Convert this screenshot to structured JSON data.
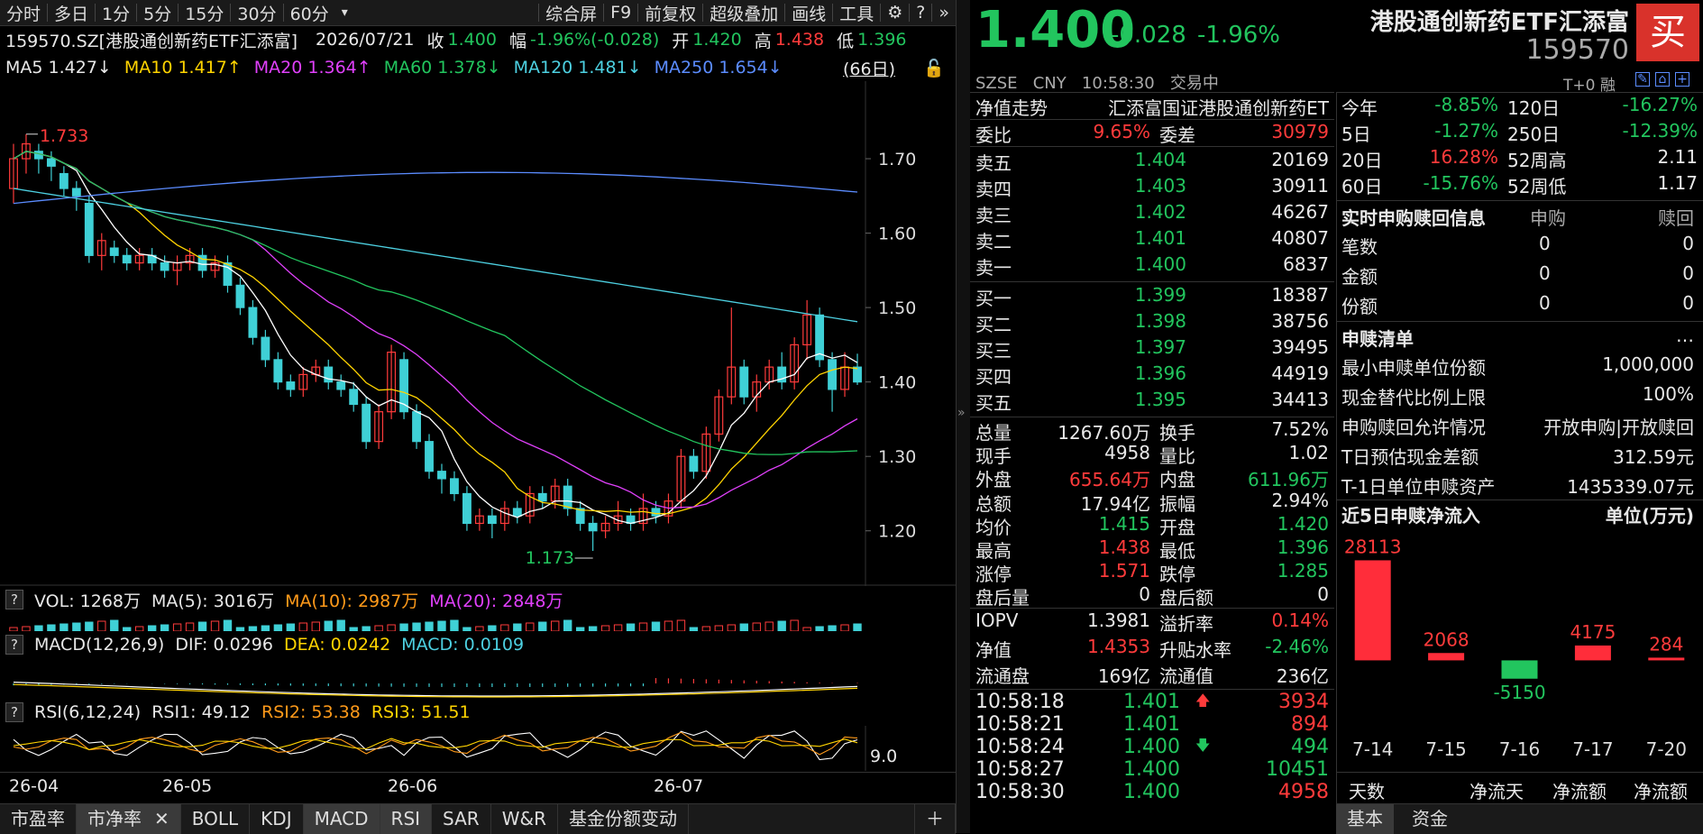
{
  "toolbar": {
    "items": [
      "分时",
      "多日",
      "1分",
      "5分",
      "15分",
      "30分",
      "60分",
      "▾"
    ],
    "right_items": [
      "综合屏",
      "F9",
      "前复权",
      "超级叠加",
      "画线",
      "工具"
    ]
  },
  "info": {
    "code": "159570.SZ[港股通创新药ETF汇添富]",
    "date": "2026/07/21",
    "close_label": "收",
    "close": "1.400",
    "amp_label": "幅",
    "amp": "-1.96%(-0.028)",
    "open_label": "开",
    "open": "1.420",
    "high_label": "高",
    "high": "1.438",
    "low_label": "低",
    "low": "1.396"
  },
  "ma": {
    "ma5": "MA5  1.427↓",
    "ma10": "MA10  1.417↑",
    "ma20": "MA20  1.364↑",
    "ma60": "MA60  1.378↓",
    "ma120": "MA120  1.481↓",
    "ma250": "MA250  1.654↓",
    "period": "(66日)"
  },
  "chart_data": {
    "type": "candlestick",
    "y_ticks": [
      "1.70",
      "1.60",
      "1.50",
      "1.40",
      "1.30",
      "1.20"
    ],
    "ylim": [
      1.15,
      1.78
    ],
    "x_ticks": [
      "26-04",
      "26-05",
      "26-06",
      "26-07"
    ],
    "annotations": {
      "max": "1.733",
      "min": "1.173"
    },
    "candles": [
      [
        1.66,
        1.7,
        1.72,
        1.64
      ],
      [
        1.7,
        1.72,
        1.733,
        1.68
      ],
      [
        1.71,
        1.7,
        1.72,
        1.68
      ],
      [
        1.7,
        1.69,
        1.71,
        1.67
      ],
      [
        1.68,
        1.66,
        1.69,
        1.65
      ],
      [
        1.66,
        1.65,
        1.67,
        1.63
      ],
      [
        1.64,
        1.57,
        1.65,
        1.56
      ],
      [
        1.57,
        1.59,
        1.6,
        1.55
      ],
      [
        1.58,
        1.57,
        1.59,
        1.56
      ],
      [
        1.57,
        1.56,
        1.58,
        1.55
      ],
      [
        1.56,
        1.57,
        1.58,
        1.55
      ],
      [
        1.57,
        1.56,
        1.58,
        1.55
      ],
      [
        1.56,
        1.55,
        1.57,
        1.54
      ],
      [
        1.55,
        1.56,
        1.57,
        1.53
      ],
      [
        1.56,
        1.57,
        1.58,
        1.55
      ],
      [
        1.57,
        1.55,
        1.58,
        1.54
      ],
      [
        1.55,
        1.56,
        1.57,
        1.54
      ],
      [
        1.56,
        1.53,
        1.57,
        1.52
      ],
      [
        1.53,
        1.5,
        1.54,
        1.49
      ],
      [
        1.5,
        1.46,
        1.51,
        1.45
      ],
      [
        1.46,
        1.43,
        1.47,
        1.42
      ],
      [
        1.43,
        1.4,
        1.44,
        1.39
      ],
      [
        1.4,
        1.39,
        1.41,
        1.38
      ],
      [
        1.39,
        1.41,
        1.42,
        1.38
      ],
      [
        1.41,
        1.42,
        1.43,
        1.4
      ],
      [
        1.42,
        1.4,
        1.43,
        1.39
      ],
      [
        1.4,
        1.39,
        1.41,
        1.38
      ],
      [
        1.39,
        1.37,
        1.4,
        1.36
      ],
      [
        1.37,
        1.32,
        1.38,
        1.31
      ],
      [
        1.32,
        1.36,
        1.37,
        1.31
      ],
      [
        1.36,
        1.44,
        1.45,
        1.35
      ],
      [
        1.43,
        1.36,
        1.44,
        1.35
      ],
      [
        1.36,
        1.32,
        1.37,
        1.31
      ],
      [
        1.32,
        1.28,
        1.33,
        1.27
      ],
      [
        1.28,
        1.27,
        1.29,
        1.25
      ],
      [
        1.27,
        1.25,
        1.28,
        1.24
      ],
      [
        1.25,
        1.21,
        1.26,
        1.2
      ],
      [
        1.21,
        1.22,
        1.23,
        1.2
      ],
      [
        1.22,
        1.21,
        1.23,
        1.19
      ],
      [
        1.21,
        1.23,
        1.24,
        1.2
      ],
      [
        1.23,
        1.22,
        1.24,
        1.21
      ],
      [
        1.22,
        1.25,
        1.26,
        1.21
      ],
      [
        1.25,
        1.24,
        1.26,
        1.23
      ],
      [
        1.24,
        1.26,
        1.27,
        1.23
      ],
      [
        1.26,
        1.23,
        1.27,
        1.22
      ],
      [
        1.23,
        1.21,
        1.24,
        1.2
      ],
      [
        1.21,
        1.2,
        1.22,
        1.173
      ],
      [
        1.2,
        1.21,
        1.22,
        1.19
      ],
      [
        1.21,
        1.22,
        1.24,
        1.2
      ],
      [
        1.22,
        1.21,
        1.23,
        1.2
      ],
      [
        1.21,
        1.23,
        1.25,
        1.2
      ],
      [
        1.23,
        1.22,
        1.24,
        1.21
      ],
      [
        1.22,
        1.24,
        1.25,
        1.21
      ],
      [
        1.24,
        1.3,
        1.31,
        1.23
      ],
      [
        1.3,
        1.28,
        1.31,
        1.27
      ],
      [
        1.28,
        1.33,
        1.34,
        1.27
      ],
      [
        1.33,
        1.38,
        1.39,
        1.32
      ],
      [
        1.38,
        1.42,
        1.5,
        1.37
      ],
      [
        1.42,
        1.38,
        1.43,
        1.37
      ],
      [
        1.38,
        1.4,
        1.41,
        1.36
      ],
      [
        1.4,
        1.42,
        1.43,
        1.39
      ],
      [
        1.42,
        1.4,
        1.44,
        1.39
      ],
      [
        1.4,
        1.45,
        1.46,
        1.39
      ],
      [
        1.45,
        1.49,
        1.51,
        1.43
      ],
      [
        1.49,
        1.43,
        1.5,
        1.42
      ],
      [
        1.43,
        1.39,
        1.44,
        1.36
      ],
      [
        1.39,
        1.42,
        1.44,
        1.38
      ],
      [
        1.42,
        1.4,
        1.438,
        1.396
      ]
    ],
    "ma_colors": {
      "ma5": "#ffffff",
      "ma10": "#ffd400",
      "ma20": "#e040fb",
      "ma60": "#22c55e",
      "ma120": "#4dd0e1",
      "ma250": "#5b8cff"
    }
  },
  "vol": {
    "label": "VOL: 1268万",
    "ma5": "MA(5): 3016万",
    "ma10": "MA(10): 2987万",
    "ma20": "MA(20): 2848万"
  },
  "macd": {
    "label": "MACD(12,26,9)",
    "dif": "DIF: 0.0296",
    "dea": "DEA: 0.0242",
    "macd": "MACD: 0.0109"
  },
  "rsi": {
    "label": "RSI(6,12,24)",
    "rsi1": "RSI1: 49.12",
    "rsi2": "RSI2: 53.38",
    "rsi3": "RSI3: 51.51",
    "tick": "9.0"
  },
  "bottom_tabs": [
    "市盈率",
    "市净率",
    "BOLL",
    "KDJ",
    "MACD",
    "RSI",
    "SAR",
    "W&R",
    "基金份额变动"
  ],
  "quote": {
    "price": "1.400",
    "change": "-0.028",
    "pct": "-1.96%",
    "exchange_line": "SZSE   CNY   10:58:30   交易中",
    "name": "港股通创新药ETF汇添富",
    "code": "159570",
    "buy_badge": "买",
    "t0": "T+0 融"
  },
  "nav_row": {
    "label": "净值走势",
    "value": "汇添富国证港股通创新药ET"
  },
  "weibi": {
    "label1": "委比",
    "val1": "9.65%",
    "label2": "委差",
    "val2": "30979"
  },
  "sells": [
    {
      "label": "卖五",
      "price": "1.404",
      "vol": "20169"
    },
    {
      "label": "卖四",
      "price": "1.403",
      "vol": "30911"
    },
    {
      "label": "卖三",
      "price": "1.402",
      "vol": "46267"
    },
    {
      "label": "卖二",
      "price": "1.401",
      "vol": "40807"
    },
    {
      "label": "卖一",
      "price": "1.400",
      "vol": "6837"
    }
  ],
  "buys": [
    {
      "label": "买一",
      "price": "1.399",
      "vol": "18387"
    },
    {
      "label": "买二",
      "price": "1.398",
      "vol": "38756"
    },
    {
      "label": "买三",
      "price": "1.397",
      "vol": "39495"
    },
    {
      "label": "买四",
      "price": "1.396",
      "vol": "44919"
    },
    {
      "label": "买五",
      "price": "1.395",
      "vol": "34413"
    }
  ],
  "stats": [
    {
      "l1": "总量",
      "v1": "1267.60万",
      "c1": "white",
      "l2": "换手",
      "v2": "7.52%",
      "c2": "white"
    },
    {
      "l1": "现手",
      "v1": "4958",
      "c1": "white",
      "l2": "量比",
      "v2": "1.02",
      "c2": "white"
    },
    {
      "l1": "外盘",
      "v1": "655.64万",
      "c1": "red",
      "l2": "内盘",
      "v2": "611.96万",
      "c2": "green"
    },
    {
      "l1": "总额",
      "v1": "17.94亿",
      "c1": "white",
      "l2": "振幅",
      "v2": "2.94%",
      "c2": "white"
    },
    {
      "l1": "均价",
      "v1": "1.415",
      "c1": "green",
      "l2": "开盘",
      "v2": "1.420",
      "c2": "green"
    },
    {
      "l1": "最高",
      "v1": "1.438",
      "c1": "red",
      "l2": "最低",
      "v2": "1.396",
      "c2": "green"
    },
    {
      "l1": "涨停",
      "v1": "1.571",
      "c1": "red",
      "l2": "跌停",
      "v2": "1.285",
      "c2": "green"
    },
    {
      "l1": "盘后量",
      "v1": "0",
      "c1": "white",
      "l2": "盘后额",
      "v2": "0",
      "c2": "white"
    }
  ],
  "stats2": [
    {
      "l1": "IOPV",
      "v1": "1.3981",
      "c1": "white",
      "l2": "溢折率",
      "v2": "0.14%",
      "c2": "red"
    },
    {
      "l1": "净值",
      "v1": "1.4353",
      "c1": "red",
      "l2": "升贴水率",
      "v2": "-2.46%",
      "c2": "green"
    },
    {
      "l1": "流通盘",
      "v1": "169亿",
      "c1": "white",
      "l2": "流通值",
      "v2": "236亿",
      "c2": "white"
    }
  ],
  "ticks": [
    {
      "time": "10:58:18",
      "price": "1.401",
      "arrow": "up",
      "vol": "3934",
      "vc": "red"
    },
    {
      "time": "10:58:21",
      "price": "1.401",
      "arrow": "",
      "vol": "894",
      "vc": "red"
    },
    {
      "time": "10:58:24",
      "price": "1.400",
      "arrow": "down",
      "vol": "494",
      "vc": "green"
    },
    {
      "time": "10:58:27",
      "price": "1.400",
      "arrow": "",
      "vol": "10451",
      "vc": "green"
    },
    {
      "time": "10:58:30",
      "price": "1.400",
      "arrow": "",
      "vol": "4958",
      "vc": "red"
    }
  ],
  "perf": [
    {
      "l1": "今年",
      "v1": "-8.85%",
      "c1": "green",
      "l2": "120日",
      "v2": "-16.27%",
      "c2": "green"
    },
    {
      "l1": "5日",
      "v1": "-1.27%",
      "c1": "green",
      "l2": "250日",
      "v2": "-12.39%",
      "c2": "green"
    },
    {
      "l1": "20日",
      "v1": "16.28%",
      "c1": "red",
      "l2": "52周高",
      "v2": "2.11",
      "c2": "white"
    },
    {
      "l1": "60日",
      "v1": "-15.76%",
      "c1": "green",
      "l2": "52周低",
      "v2": "1.17",
      "c2": "white"
    }
  ],
  "subred": {
    "title": "实时申购赎回信息",
    "col1": "申购",
    "col2": "赎回",
    "rows": [
      {
        "l": "笔数",
        "a": "0",
        "b": "0"
      },
      {
        "l": "金额",
        "a": "0",
        "b": "0"
      },
      {
        "l": "份额",
        "a": "0",
        "b": "0"
      }
    ]
  },
  "list": {
    "title": "申赎清单",
    "rows": [
      {
        "l": "最小申赎单位份额",
        "v": "1,000,000"
      },
      {
        "l": "现金替代比例上限",
        "v": "100%"
      },
      {
        "l": "申购赎回允许情况",
        "v": "开放申购|开放赎回"
      },
      {
        "l": "T日预估现金差额",
        "v": "312.59元"
      },
      {
        "l": "T-1日单位申赎资产",
        "v": "1435339.07元"
      }
    ]
  },
  "flow": {
    "title": "近5日申赎净流入",
    "unit": "单位(万元)",
    "ylim": [
      -8000,
      30000
    ],
    "bars": [
      {
        "date": "7-14",
        "value": 28113,
        "label": "28113"
      },
      {
        "date": "7-15",
        "value": 2068,
        "label": "2068"
      },
      {
        "date": "7-16",
        "value": -5150,
        "label": "-5150"
      },
      {
        "date": "7-17",
        "value": 4175,
        "label": "4175"
      },
      {
        "date": "7-20",
        "value": 284,
        "label": "284"
      }
    ]
  },
  "flow_footer": [
    "天数",
    "净流天",
    "净流额",
    "净流额"
  ],
  "right_tabs": [
    "基本",
    "资金"
  ],
  "colors": {
    "up": "#ff3b3b",
    "down": "#22c55e",
    "candle_down": "#3fd0d6",
    "bg": "#000000"
  }
}
